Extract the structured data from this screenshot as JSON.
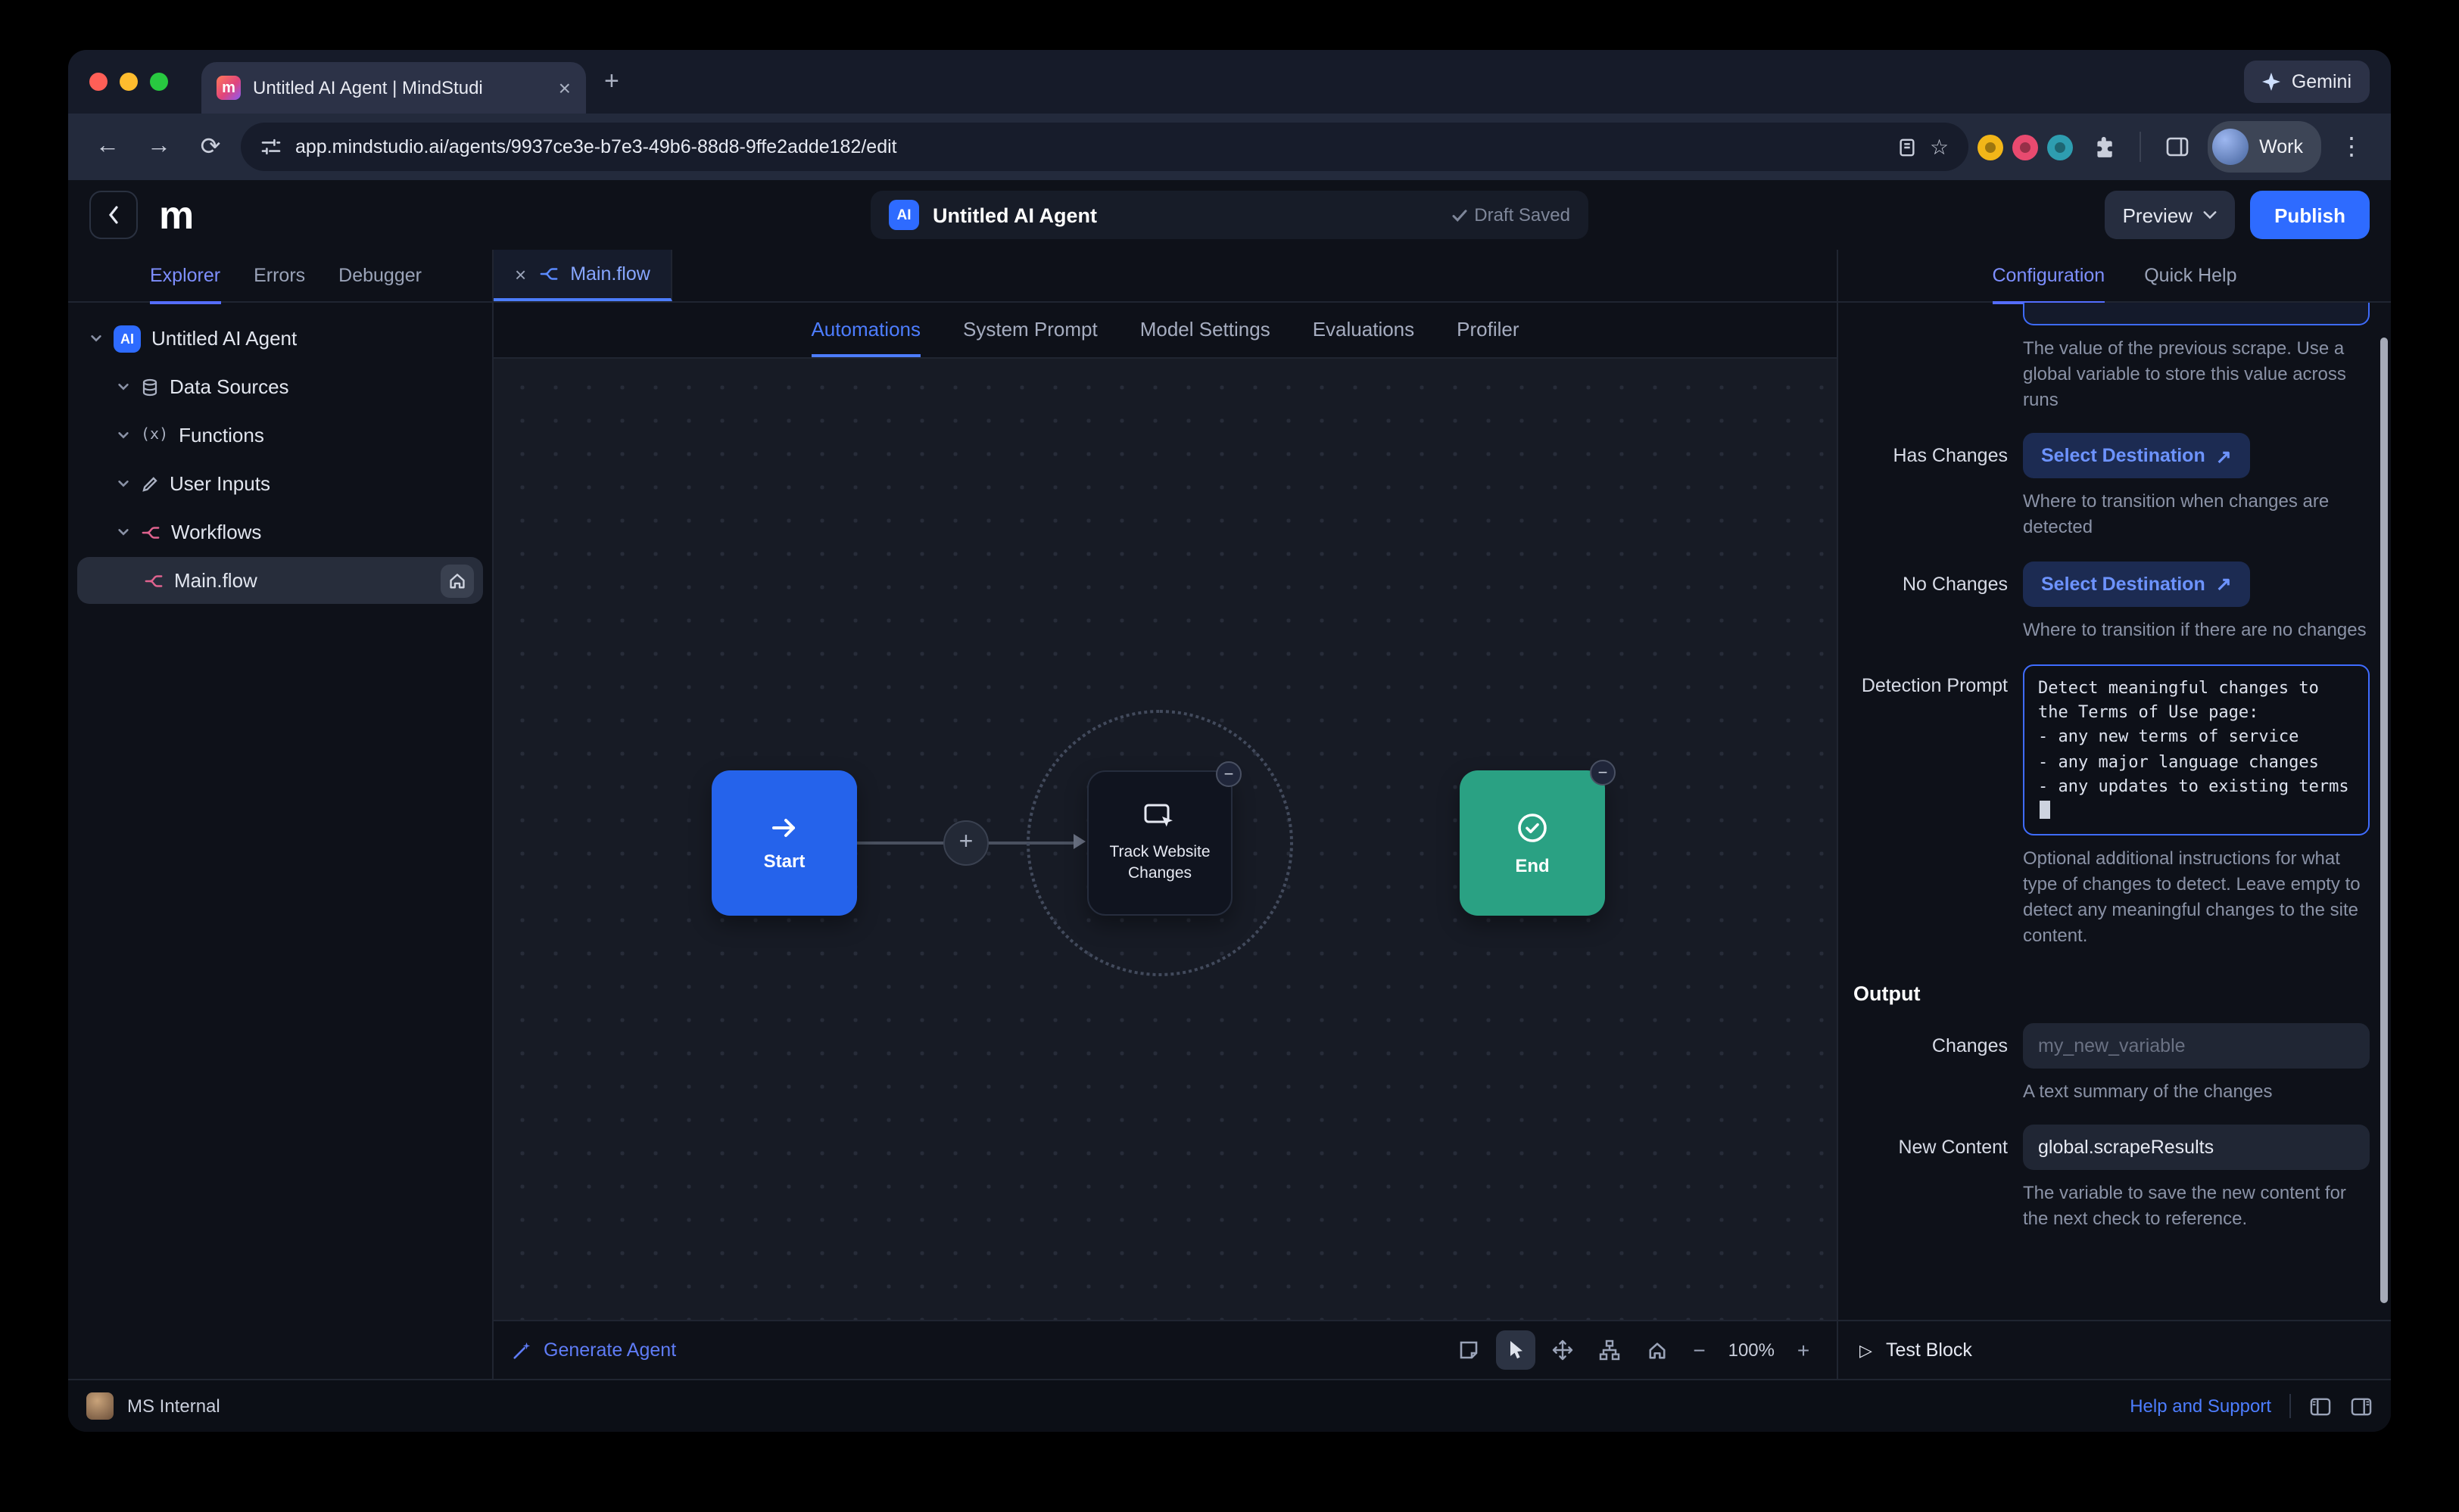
{
  "colors": {
    "accent": "#4c7dff",
    "publish_button": "#2e6bff",
    "start_node": "#2563eb",
    "end_node": "#2aa183",
    "selection_border": "#3f6cff"
  },
  "browser": {
    "tab_title": "Untitled AI Agent | MindStudi",
    "favicon_letter": "m",
    "gemini_label": "Gemini",
    "url": "app.mindstudio.ai/agents/9937ce3e-b7e3-49b6-88d8-9ffe2adde182/edit",
    "work_label": "Work"
  },
  "header": {
    "logo_letter": "m",
    "ai_badge": "AI",
    "title": "Untitled AI Agent",
    "draft_status": "Draft Saved",
    "preview_label": "Preview",
    "publish_label": "Publish"
  },
  "sidebar": {
    "tabs": [
      {
        "label": "Explorer"
      },
      {
        "label": "Errors"
      },
      {
        "label": "Debugger"
      }
    ],
    "tree": [
      {
        "label": "Untitled AI Agent"
      },
      {
        "label": "Data Sources"
      },
      {
        "label": "Functions"
      },
      {
        "label": "User Inputs"
      },
      {
        "label": "Workflows"
      },
      {
        "label": "Main.flow"
      }
    ]
  },
  "editor": {
    "file_tab": "Main.flow",
    "tabs": [
      {
        "label": "Automations"
      },
      {
        "label": "System Prompt"
      },
      {
        "label": "Model Settings"
      },
      {
        "label": "Evaluations"
      },
      {
        "label": "Profiler"
      }
    ],
    "nodes": {
      "start": "Start",
      "track": "Track Website Changes",
      "end": "End"
    },
    "generate_label": "Generate Agent",
    "zoom_level": "100%"
  },
  "config": {
    "tabs": [
      {
        "label": "Configuration"
      },
      {
        "label": "Quick Help"
      }
    ],
    "scrolled_helper": "The value of the previous scrape. Use a global variable to store this value across runs",
    "has_changes": {
      "label": "Has Changes",
      "button": "Select Destination",
      "helper": "Where to transition when changes are detected"
    },
    "no_changes": {
      "label": "No Changes",
      "button": "Select Destination",
      "helper": "Where to transition if there are no changes"
    },
    "detection_prompt": {
      "label": "Detection Prompt",
      "value": "Detect meaningful changes to the Terms of Use page:\n- any new terms of service\n- any major language changes\n- any updates to existing terms",
      "helper": "Optional additional instructions for what type of changes to detect. Leave empty to detect any meaningful changes to the site content."
    },
    "output_heading": "Output",
    "changes": {
      "label": "Changes",
      "placeholder": "my_new_variable",
      "helper": "A text summary of the changes"
    },
    "new_content": {
      "label": "New Content",
      "value": "global.scrapeResults",
      "helper": "The variable to save the new content for the next check to reference."
    },
    "test_block_label": "Test Block"
  },
  "status_bar": {
    "workspace": "MS Internal",
    "help_label": "Help and Support"
  }
}
